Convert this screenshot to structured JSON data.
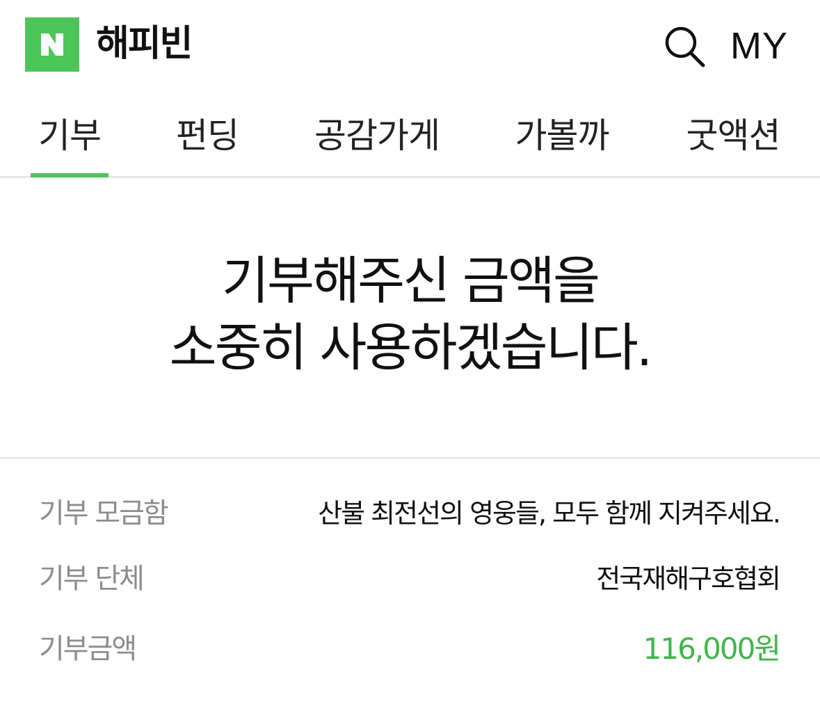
{
  "header": {
    "logo_letter": "N",
    "service_title": "해피빈",
    "search_icon": "search-icon",
    "my_label": "MY",
    "brand_color": "#4cc55a"
  },
  "tabs": [
    {
      "label": "기부",
      "active": true
    },
    {
      "label": "펀딩",
      "active": false
    },
    {
      "label": "공감가게",
      "active": false
    },
    {
      "label": "가볼까",
      "active": false
    },
    {
      "label": "굿액션",
      "active": false
    }
  ],
  "message": {
    "line1": "기부해주신 금액을",
    "line2": "소중히 사용하겠습니다."
  },
  "details": [
    {
      "label": "기부 모금함",
      "value": "산불 최전선의 영웅들, 모두 함께 지켜주세요."
    },
    {
      "label": "기부 단체",
      "value": "전국재해구호협회"
    },
    {
      "label": "기부금액",
      "value": "116,000원",
      "accent_color": "#3fb54b"
    }
  ]
}
